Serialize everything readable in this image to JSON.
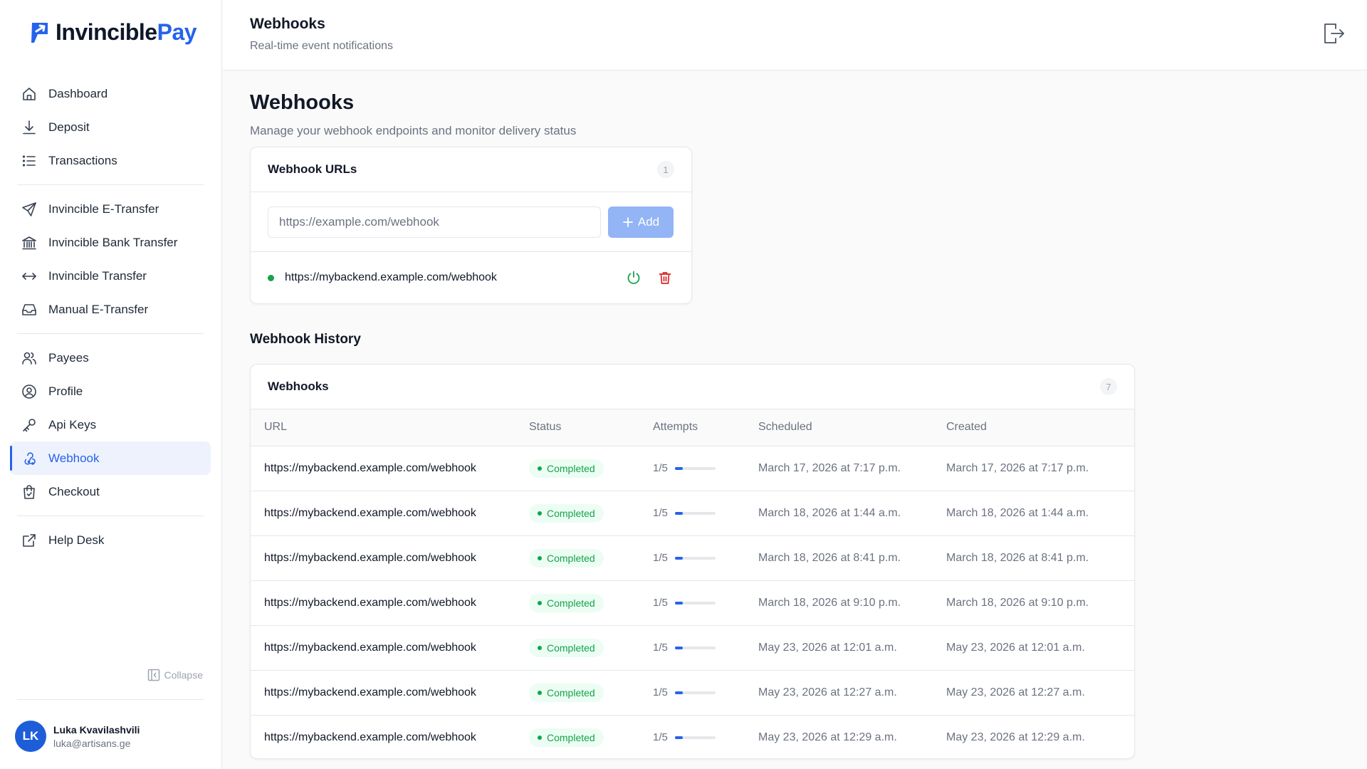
{
  "brand": {
    "name_primary": "Invincible",
    "name_accent": "Pay",
    "accent_color": "#2563eb"
  },
  "sidebar": {
    "groups": [
      [
        {
          "label": "Dashboard",
          "icon": "home-icon"
        },
        {
          "label": "Deposit",
          "icon": "download-icon"
        },
        {
          "label": "Transactions",
          "icon": "list-icon"
        }
      ],
      [
        {
          "label": "Invincible E-Transfer",
          "icon": "send-icon"
        },
        {
          "label": "Invincible Bank Transfer",
          "icon": "bank-icon"
        },
        {
          "label": "Invincible Transfer",
          "icon": "arrows-horizontal-icon"
        },
        {
          "label": "Manual E-Transfer",
          "icon": "inbox-icon"
        }
      ],
      [
        {
          "label": "Payees",
          "icon": "users-icon"
        },
        {
          "label": "Profile",
          "icon": "user-circle-icon"
        },
        {
          "label": "Api Keys",
          "icon": "key-icon"
        },
        {
          "label": "Webhook",
          "icon": "webhook-icon",
          "active": true
        },
        {
          "label": "Checkout",
          "icon": "shopping-bag-icon"
        }
      ],
      [
        {
          "label": "Help Desk",
          "icon": "external-link-icon"
        }
      ]
    ],
    "collapse_label": "Collapse",
    "user": {
      "initials": "LK",
      "name": "Luka Kvavilashvili",
      "email": "luka@artisans.ge"
    }
  },
  "header": {
    "title": "Webhooks",
    "subtitle": "Real-time event notifications"
  },
  "main": {
    "title": "Webhooks",
    "subtitle": "Manage your webhook endpoints and monitor delivery status",
    "urls_card": {
      "title": "Webhook URLs",
      "count": "1",
      "input_value": "",
      "input_placeholder": "https://example.com/webhook",
      "add_label": "Add",
      "endpoints": [
        {
          "url": "https://mybackend.example.com/webhook",
          "active": true
        }
      ]
    },
    "history_title": "Webhook History",
    "history_card": {
      "title": "Webhooks",
      "count": "7",
      "columns": [
        "URL",
        "Status",
        "Attempts",
        "Scheduled",
        "Created"
      ],
      "rows": [
        {
          "url": "https://mybackend.example.com/webhook",
          "status": "Completed",
          "attempts": "1/5",
          "progress": 0.2,
          "scheduled": "March 17, 2026 at 7:17 p.m.",
          "created": "March 17, 2026 at 7:17 p.m."
        },
        {
          "url": "https://mybackend.example.com/webhook",
          "status": "Completed",
          "attempts": "1/5",
          "progress": 0.2,
          "scheduled": "March 18, 2026 at 1:44 a.m.",
          "created": "March 18, 2026 at 1:44 a.m."
        },
        {
          "url": "https://mybackend.example.com/webhook",
          "status": "Completed",
          "attempts": "1/5",
          "progress": 0.2,
          "scheduled": "March 18, 2026 at 8:41 p.m.",
          "created": "March 18, 2026 at 8:41 p.m."
        },
        {
          "url": "https://mybackend.example.com/webhook",
          "status": "Completed",
          "attempts": "1/5",
          "progress": 0.2,
          "scheduled": "March 18, 2026 at 9:10 p.m.",
          "created": "March 18, 2026 at 9:10 p.m."
        },
        {
          "url": "https://mybackend.example.com/webhook",
          "status": "Completed",
          "attempts": "1/5",
          "progress": 0.2,
          "scheduled": "May 23, 2026 at 12:01 a.m.",
          "created": "May 23, 2026 at 12:01 a.m."
        },
        {
          "url": "https://mybackend.example.com/webhook",
          "status": "Completed",
          "attempts": "1/5",
          "progress": 0.2,
          "scheduled": "May 23, 2026 at 12:27 a.m.",
          "created": "May 23, 2026 at 12:27 a.m."
        },
        {
          "url": "https://mybackend.example.com/webhook",
          "status": "Completed",
          "attempts": "1/5",
          "progress": 0.2,
          "scheduled": "May 23, 2026 at 12:29 a.m.",
          "created": "May 23, 2026 at 12:29 a.m."
        }
      ]
    }
  }
}
